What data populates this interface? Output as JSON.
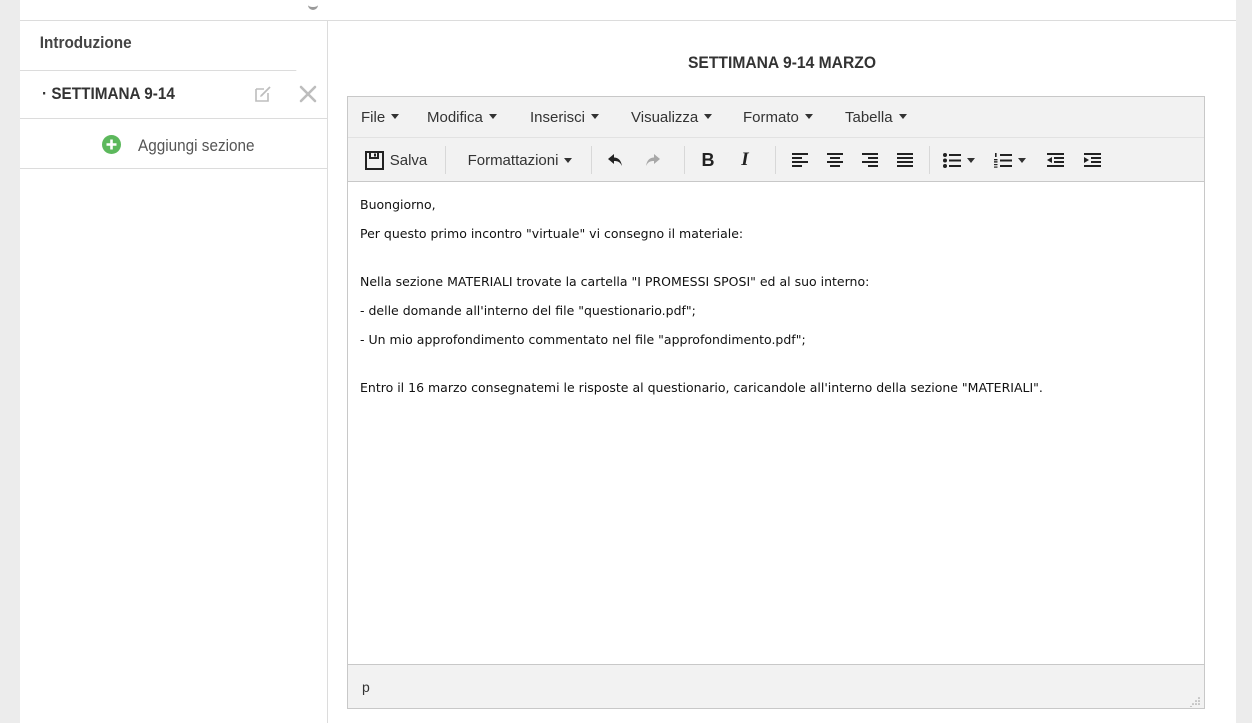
{
  "sidebar": {
    "intro_label": "Introduzione",
    "section_label": "· SETTIMANA 9-14",
    "add_section_label": "Aggiungi sezione",
    "icons": {
      "edit": "edit-icon",
      "close": "close-icon",
      "add": "plus-circle-icon"
    }
  },
  "main": {
    "title": "SETTIMANA 9-14 MARZO"
  },
  "editor": {
    "menubar": [
      "File",
      "Modifica",
      "Inserisci",
      "Visualizza",
      "Formato",
      "Tabella"
    ],
    "toolbar": {
      "save_label": "Salva",
      "formats_label": "Formattazioni"
    },
    "content": [
      "Buongiorno,",
      "Per questo primo incontro \"virtuale\" vi consegno il materiale:",
      "",
      "Nella sezione MATERIALI trovate la cartella \"I PROMESSI SPOSI\" ed al suo interno:",
      "- delle domande all'interno del file \"questionario.pdf\";",
      "- Un mio approfondimento commentato nel file \"approfondimento.pdf\";",
      "",
      "Entro il 16 marzo consegnatemi le risposte al questionario, caricandole all'interno della sezione \"MATERIALI\"."
    ],
    "status_path": "p"
  },
  "colors": {
    "accent_green": "#5cb85c",
    "toolbar_bg": "#f2f2f2",
    "border": "#c8c8c8"
  }
}
